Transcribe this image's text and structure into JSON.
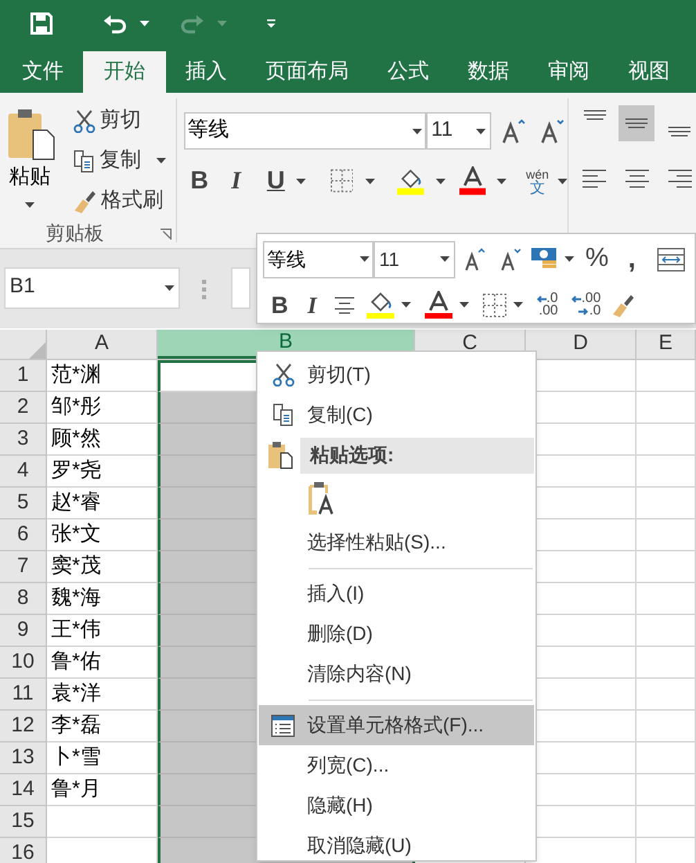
{
  "quick_access": [
    {
      "disabled": false
    },
    {
      "disabled": false
    },
    {
      "disabled": false
    },
    {
      "disabled": true
    },
    {
      "disabled": true
    },
    {
      "disabled": false
    }
  ],
  "tabs": [
    {
      "label": "文件",
      "selected": false
    },
    {
      "label": "开始",
      "selected": true
    },
    {
      "label": "插入",
      "selected": false
    },
    {
      "label": "页面布局",
      "selected": false
    },
    {
      "label": "公式",
      "selected": false
    },
    {
      "label": "数据",
      "selected": false
    },
    {
      "label": "审阅",
      "selected": false
    },
    {
      "label": "视图",
      "selected": false
    }
  ],
  "ribbon": {
    "clipboard": {
      "paste": "粘贴",
      "items": [
        "剪切",
        "复制",
        "格式刷"
      ],
      "label": "剪贴板"
    },
    "font": {
      "font_name": "等线",
      "font_size": "11",
      "bold": "B",
      "italic": "I",
      "underline": "U",
      "phonetic": {
        "ruby": "wén",
        "base": "文"
      }
    },
    "alignment": [
      {
        "selected": false
      },
      {
        "selected": true
      },
      {
        "selected": false
      },
      {
        "selected": false
      },
      {
        "selected": false
      },
      {
        "selected": false
      }
    ]
  },
  "name_box": "B1",
  "mini_toolbar": {
    "font_name": "等线",
    "font_size": "11",
    "bold": "B",
    "italic": "I",
    "percent": "%",
    "comma": ",",
    "decimals": [
      {
        "top": ".0",
        "bottom": ".00"
      },
      {
        "top": ".00",
        "bottom": ".0"
      }
    ]
  },
  "sheet": {
    "columns": [
      {
        "label": "A",
        "selected": false
      },
      {
        "label": "B",
        "selected": true
      },
      {
        "label": "C",
        "selected": false
      },
      {
        "label": "D",
        "selected": false
      },
      {
        "label": "E",
        "selected": false
      }
    ],
    "rows": [
      {
        "number": "1",
        "a": "范*渊"
      },
      {
        "number": "2",
        "a": "邹*彤"
      },
      {
        "number": "3",
        "a": "顾*然"
      },
      {
        "number": "4",
        "a": "罗*尧"
      },
      {
        "number": "5",
        "a": "赵*睿"
      },
      {
        "number": "6",
        "a": "张*文"
      },
      {
        "number": "7",
        "a": "窦*茂"
      },
      {
        "number": "8",
        "a": "魏*海"
      },
      {
        "number": "9",
        "a": "王*伟"
      },
      {
        "number": "10",
        "a": "鲁*佑"
      },
      {
        "number": "11",
        "a": "袁*洋"
      },
      {
        "number": "12",
        "a": "李*磊"
      },
      {
        "number": "13",
        "a": "卜*雪"
      },
      {
        "number": "14",
        "a": "鲁*月"
      },
      {
        "number": "15"
      },
      {
        "number": "16"
      }
    ]
  },
  "context_menu": [
    {
      "kind": "item",
      "label": "剪切(T)",
      "selected": false
    },
    {
      "kind": "item",
      "label": "复制(C)",
      "selected": false
    },
    {
      "kind": "header",
      "label": "粘贴选项:"
    },
    {
      "kind": "paste_option"
    },
    {
      "kind": "item",
      "label": "选择性粘贴(S)...",
      "selected": false
    },
    {
      "kind": "separator"
    },
    {
      "kind": "item",
      "label": "插入(I)",
      "selected": false
    },
    {
      "kind": "item",
      "label": "删除(D)",
      "selected": false
    },
    {
      "kind": "item",
      "label": "清除内容(N)",
      "selected": false
    },
    {
      "kind": "separator"
    },
    {
      "kind": "item",
      "label": "设置单元格格式(F)...",
      "selected": true
    },
    {
      "kind": "item",
      "label": "列宽(C)...",
      "selected": false
    },
    {
      "kind": "item",
      "label": "隐藏(H)",
      "selected": false
    },
    {
      "kind": "item",
      "label": "取消隐藏(U)",
      "selected": false
    }
  ]
}
